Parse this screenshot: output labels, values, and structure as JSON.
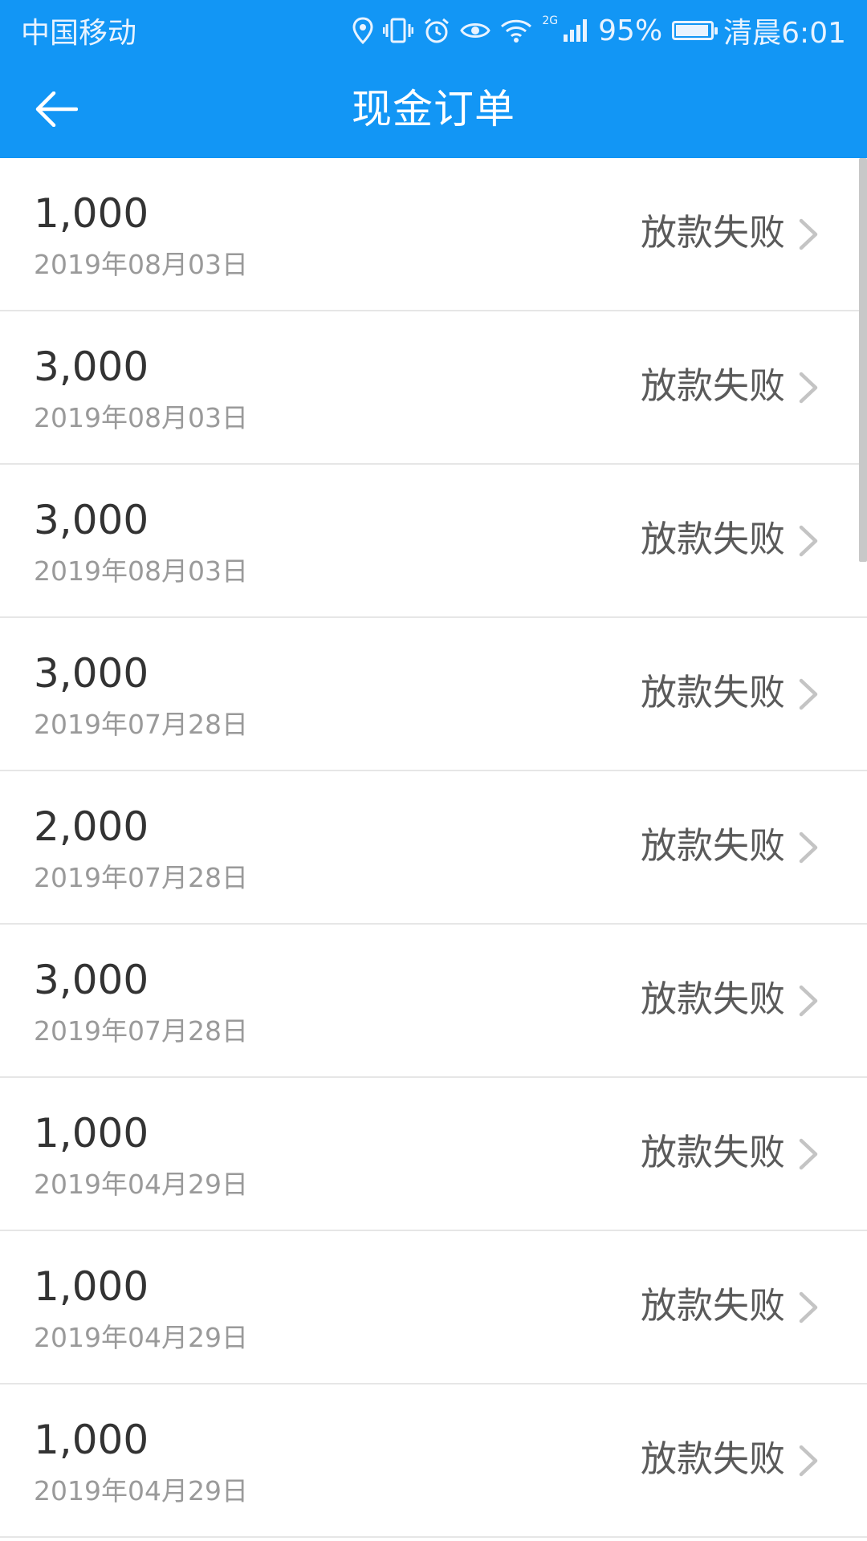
{
  "status_bar": {
    "carrier": "中国移动",
    "network": "2G",
    "battery_percent": "95%",
    "battery_level": 0.95,
    "time": "清晨6:01",
    "icons": [
      "location-icon",
      "vibrate-icon",
      "alarm-icon",
      "eye-icon",
      "wifi-icon",
      "signal-icon",
      "battery-icon"
    ]
  },
  "header": {
    "title": "现金订单",
    "back_icon": "back-arrow-icon"
  },
  "colors": {
    "header_bg": "#1296f5",
    "amount_text": "#333333",
    "date_text": "#9a9a9a",
    "status_text": "#5a5a5a",
    "divider": "#e6e6e6"
  },
  "orders": [
    {
      "amount": "1,000",
      "date": "2019年08月03日",
      "status": "放款失败"
    },
    {
      "amount": "3,000",
      "date": "2019年08月03日",
      "status": "放款失败"
    },
    {
      "amount": "3,000",
      "date": "2019年08月03日",
      "status": "放款失败"
    },
    {
      "amount": "3,000",
      "date": "2019年07月28日",
      "status": "放款失败"
    },
    {
      "amount": "2,000",
      "date": "2019年07月28日",
      "status": "放款失败"
    },
    {
      "amount": "3,000",
      "date": "2019年07月28日",
      "status": "放款失败"
    },
    {
      "amount": "1,000",
      "date": "2019年04月29日",
      "status": "放款失败"
    },
    {
      "amount": "1,000",
      "date": "2019年04月29日",
      "status": "放款失败"
    },
    {
      "amount": "1,000",
      "date": "2019年04月29日",
      "status": "放款失败"
    }
  ]
}
